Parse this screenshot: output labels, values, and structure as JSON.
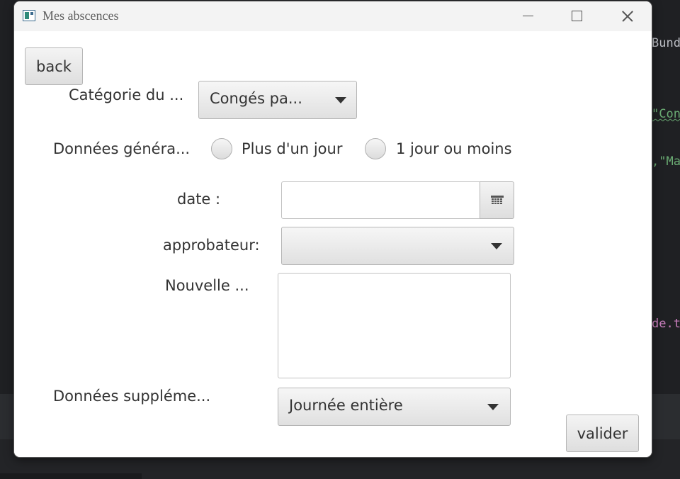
{
  "window": {
    "title": "Mes abscences"
  },
  "form": {
    "back_label": "back",
    "category_label": "Catégorie du ...",
    "category_value": "Congés pa...",
    "general_label": "Données généra...",
    "radio_multi_label": "Plus d'un jour",
    "radio_single_label": "1 jour ou moins",
    "date_label": "date :",
    "date_value": "",
    "approver_label": "approbateur:",
    "approver_value": "",
    "new_label": "Nouvelle ...",
    "new_value": "",
    "extra_label": "Données suppléme...",
    "extra_value": "Journée entière",
    "submit_label": "valider"
  },
  "background_code": {
    "line1": "Bund",
    "line2": "\"Con",
    "line3": ",\"Ma",
    "line4": "de.t"
  },
  "icons": [
    "app-icon",
    "minimize-icon",
    "maximize-icon",
    "close-icon",
    "chevron-down-icon",
    "calendar-icon"
  ]
}
